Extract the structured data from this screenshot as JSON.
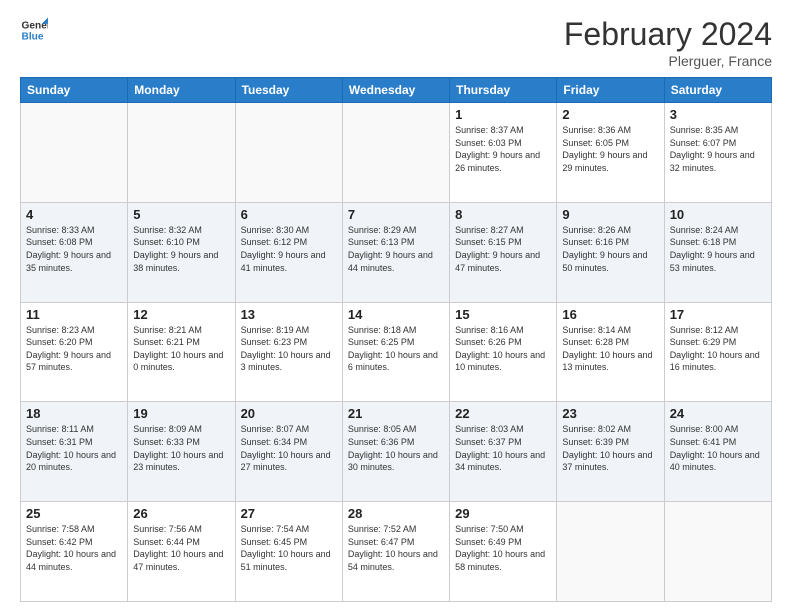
{
  "header": {
    "logo_line1": "General",
    "logo_line2": "Blue",
    "month_title": "February 2024",
    "location": "Plerguer, France"
  },
  "days_of_week": [
    "Sunday",
    "Monday",
    "Tuesday",
    "Wednesday",
    "Thursday",
    "Friday",
    "Saturday"
  ],
  "weeks": [
    [
      {
        "num": "",
        "info": ""
      },
      {
        "num": "",
        "info": ""
      },
      {
        "num": "",
        "info": ""
      },
      {
        "num": "",
        "info": ""
      },
      {
        "num": "1",
        "info": "Sunrise: 8:37 AM\nSunset: 6:03 PM\nDaylight: 9 hours and 26 minutes."
      },
      {
        "num": "2",
        "info": "Sunrise: 8:36 AM\nSunset: 6:05 PM\nDaylight: 9 hours and 29 minutes."
      },
      {
        "num": "3",
        "info": "Sunrise: 8:35 AM\nSunset: 6:07 PM\nDaylight: 9 hours and 32 minutes."
      }
    ],
    [
      {
        "num": "4",
        "info": "Sunrise: 8:33 AM\nSunset: 6:08 PM\nDaylight: 9 hours and 35 minutes."
      },
      {
        "num": "5",
        "info": "Sunrise: 8:32 AM\nSunset: 6:10 PM\nDaylight: 9 hours and 38 minutes."
      },
      {
        "num": "6",
        "info": "Sunrise: 8:30 AM\nSunset: 6:12 PM\nDaylight: 9 hours and 41 minutes."
      },
      {
        "num": "7",
        "info": "Sunrise: 8:29 AM\nSunset: 6:13 PM\nDaylight: 9 hours and 44 minutes."
      },
      {
        "num": "8",
        "info": "Sunrise: 8:27 AM\nSunset: 6:15 PM\nDaylight: 9 hours and 47 minutes."
      },
      {
        "num": "9",
        "info": "Sunrise: 8:26 AM\nSunset: 6:16 PM\nDaylight: 9 hours and 50 minutes."
      },
      {
        "num": "10",
        "info": "Sunrise: 8:24 AM\nSunset: 6:18 PM\nDaylight: 9 hours and 53 minutes."
      }
    ],
    [
      {
        "num": "11",
        "info": "Sunrise: 8:23 AM\nSunset: 6:20 PM\nDaylight: 9 hours and 57 minutes."
      },
      {
        "num": "12",
        "info": "Sunrise: 8:21 AM\nSunset: 6:21 PM\nDaylight: 10 hours and 0 minutes."
      },
      {
        "num": "13",
        "info": "Sunrise: 8:19 AM\nSunset: 6:23 PM\nDaylight: 10 hours and 3 minutes."
      },
      {
        "num": "14",
        "info": "Sunrise: 8:18 AM\nSunset: 6:25 PM\nDaylight: 10 hours and 6 minutes."
      },
      {
        "num": "15",
        "info": "Sunrise: 8:16 AM\nSunset: 6:26 PM\nDaylight: 10 hours and 10 minutes."
      },
      {
        "num": "16",
        "info": "Sunrise: 8:14 AM\nSunset: 6:28 PM\nDaylight: 10 hours and 13 minutes."
      },
      {
        "num": "17",
        "info": "Sunrise: 8:12 AM\nSunset: 6:29 PM\nDaylight: 10 hours and 16 minutes."
      }
    ],
    [
      {
        "num": "18",
        "info": "Sunrise: 8:11 AM\nSunset: 6:31 PM\nDaylight: 10 hours and 20 minutes."
      },
      {
        "num": "19",
        "info": "Sunrise: 8:09 AM\nSunset: 6:33 PM\nDaylight: 10 hours and 23 minutes."
      },
      {
        "num": "20",
        "info": "Sunrise: 8:07 AM\nSunset: 6:34 PM\nDaylight: 10 hours and 27 minutes."
      },
      {
        "num": "21",
        "info": "Sunrise: 8:05 AM\nSunset: 6:36 PM\nDaylight: 10 hours and 30 minutes."
      },
      {
        "num": "22",
        "info": "Sunrise: 8:03 AM\nSunset: 6:37 PM\nDaylight: 10 hours and 34 minutes."
      },
      {
        "num": "23",
        "info": "Sunrise: 8:02 AM\nSunset: 6:39 PM\nDaylight: 10 hours and 37 minutes."
      },
      {
        "num": "24",
        "info": "Sunrise: 8:00 AM\nSunset: 6:41 PM\nDaylight: 10 hours and 40 minutes."
      }
    ],
    [
      {
        "num": "25",
        "info": "Sunrise: 7:58 AM\nSunset: 6:42 PM\nDaylight: 10 hours and 44 minutes."
      },
      {
        "num": "26",
        "info": "Sunrise: 7:56 AM\nSunset: 6:44 PM\nDaylight: 10 hours and 47 minutes."
      },
      {
        "num": "27",
        "info": "Sunrise: 7:54 AM\nSunset: 6:45 PM\nDaylight: 10 hours and 51 minutes."
      },
      {
        "num": "28",
        "info": "Sunrise: 7:52 AM\nSunset: 6:47 PM\nDaylight: 10 hours and 54 minutes."
      },
      {
        "num": "29",
        "info": "Sunrise: 7:50 AM\nSunset: 6:49 PM\nDaylight: 10 hours and 58 minutes."
      },
      {
        "num": "",
        "info": ""
      },
      {
        "num": "",
        "info": ""
      }
    ]
  ]
}
